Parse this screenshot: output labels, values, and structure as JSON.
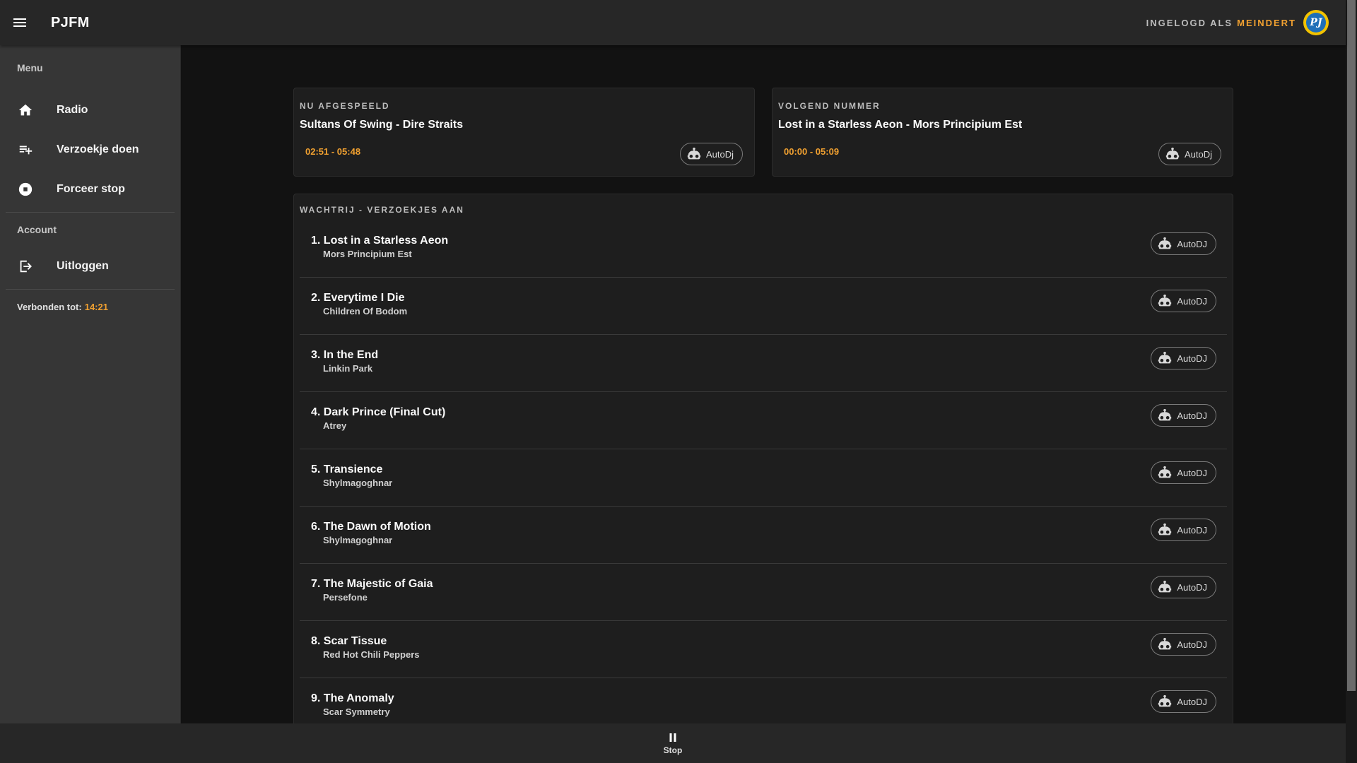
{
  "app": {
    "title": "PJFM",
    "menu_icon": "menu-icon"
  },
  "header": {
    "login_prefix": "INGELOGD ALS",
    "login_user": "MEINDERT",
    "avatar_text": "PJ"
  },
  "sidebar": {
    "menu_header": "Menu",
    "items": [
      {
        "label": "Radio",
        "icon": "home-icon"
      },
      {
        "label": "Verzoekje doen",
        "icon": "playlist-add-icon"
      },
      {
        "label": "Forceer stop",
        "icon": "stop-circle-icon"
      }
    ],
    "account_header": "Account",
    "account_items": [
      {
        "label": "Uitloggen",
        "icon": "logout-icon"
      }
    ],
    "connected_label": "Verbonden tot:",
    "connected_time": "14:21"
  },
  "now_playing": {
    "overline": "NU AFGESPEELD",
    "title": "Sultans Of Swing - Dire Straits",
    "time": "02:51 - 05:48",
    "chip": "AutoDj"
  },
  "next_up": {
    "overline": "VOLGEND NUMMER",
    "title": "Lost in a Starless Aeon - Mors Principium Est",
    "time": "00:00 - 05:09",
    "chip": "AutoDj"
  },
  "queue": {
    "overline": "WACHTRIJ - VERZOEKJES AAN",
    "items": [
      {
        "title": "1. Lost in a Starless Aeon",
        "artist": "Mors Principium Est",
        "chip": "AutoDJ"
      },
      {
        "title": "2. Everytime I Die",
        "artist": "Children Of Bodom",
        "chip": "AutoDJ"
      },
      {
        "title": "3. In the End",
        "artist": "Linkin Park",
        "chip": "AutoDJ"
      },
      {
        "title": "4. Dark Prince (Final Cut)",
        "artist": "Atrey",
        "chip": "AutoDJ"
      },
      {
        "title": "5. Transience",
        "artist": "Shylmagoghnar",
        "chip": "AutoDJ"
      },
      {
        "title": "6. The Dawn of Motion",
        "artist": "Shylmagoghnar",
        "chip": "AutoDJ"
      },
      {
        "title": "7. The Majestic of Gaia",
        "artist": "Persefone",
        "chip": "AutoDJ"
      },
      {
        "title": "8. Scar Tissue",
        "artist": "Red Hot Chili Peppers",
        "chip": "AutoDJ"
      },
      {
        "title": "9. The Anomaly",
        "artist": "Scar Symmetry",
        "chip": "AutoDJ"
      }
    ]
  },
  "bottom": {
    "stop_label": "Stop",
    "stop_icon": "pause-icon"
  },
  "colors": {
    "accent": "#f0a030",
    "background": "#121212",
    "surface": "#1e1e1e",
    "bar": "#272727",
    "sidebar": "#363636"
  }
}
